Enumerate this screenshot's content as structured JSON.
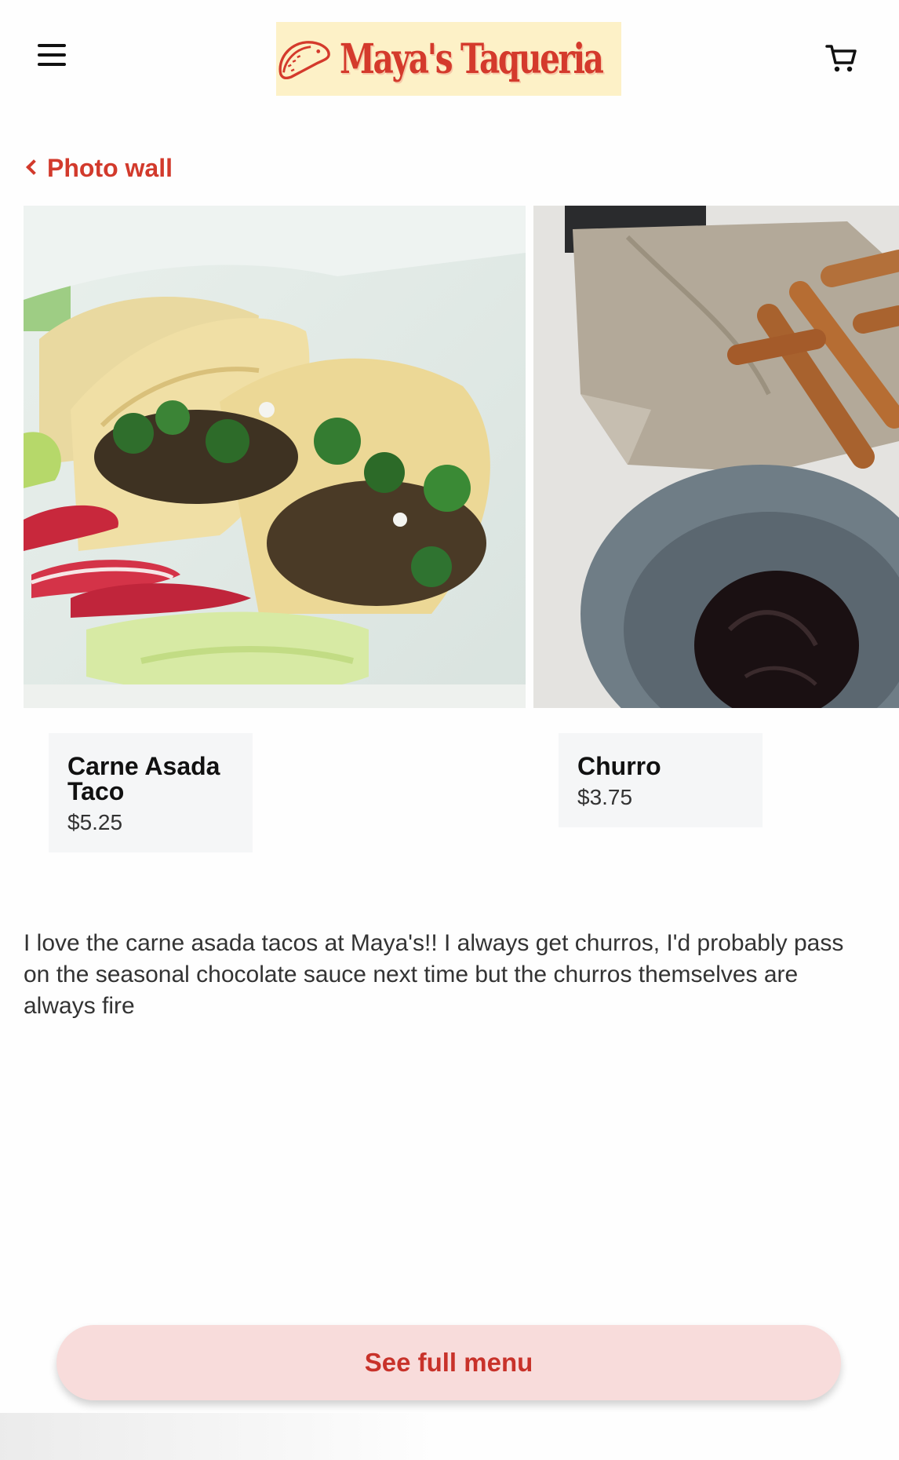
{
  "header": {
    "logo_text": "Maya's Taqueria",
    "menu_icon": "hamburger-menu-icon",
    "cart_icon": "shopping-cart-icon"
  },
  "nav": {
    "back_label": "Photo wall"
  },
  "photos": [
    {
      "name": "carne-asada-taco-photo",
      "subject": "Carne asada tacos"
    },
    {
      "name": "churro-photo",
      "subject": "Churros with chocolate sauce"
    }
  ],
  "items": [
    {
      "name": "Carne Asada Taco",
      "price": "$5.25"
    },
    {
      "name": "Churro",
      "price": "$3.75"
    }
  ],
  "review": {
    "text": "I love the carne asada tacos at Maya's!! I always get churros, I'd probably pass on the seasonal chocolate sauce next time but the churros themselves are always fire"
  },
  "actions": {
    "full_menu_label": "See full menu"
  },
  "colors": {
    "accent": "#d23a2c",
    "logo_bg": "#fdf1c7",
    "card_bg": "#f5f6f7",
    "button_bg": "#f8dcdb"
  }
}
